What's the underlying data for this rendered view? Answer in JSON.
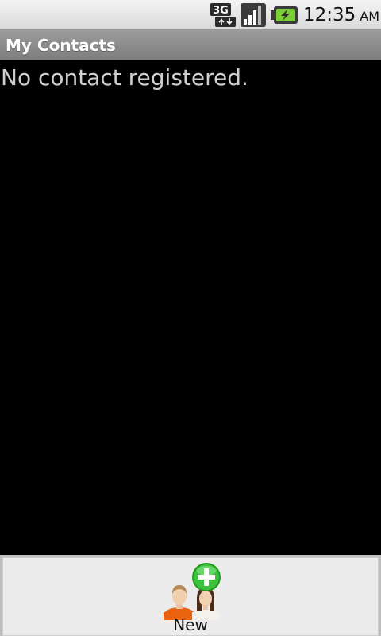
{
  "status_bar": {
    "network_type": "3G",
    "time": "12:35",
    "ampm": "AM"
  },
  "title_bar": {
    "title": "My Contacts"
  },
  "main": {
    "empty_message": "No contact registered."
  },
  "options_menu": {
    "items": [
      {
        "label": "New",
        "icon": "add-contact-icon"
      }
    ]
  },
  "colors": {
    "status_bar_bg": "#e6e6e6",
    "title_bar_bg": "#8c8c8c",
    "content_bg": "#000000",
    "menu_bg": "#ececec",
    "plus_badge": "#2bb12b",
    "person_orange": "#e8620f"
  }
}
